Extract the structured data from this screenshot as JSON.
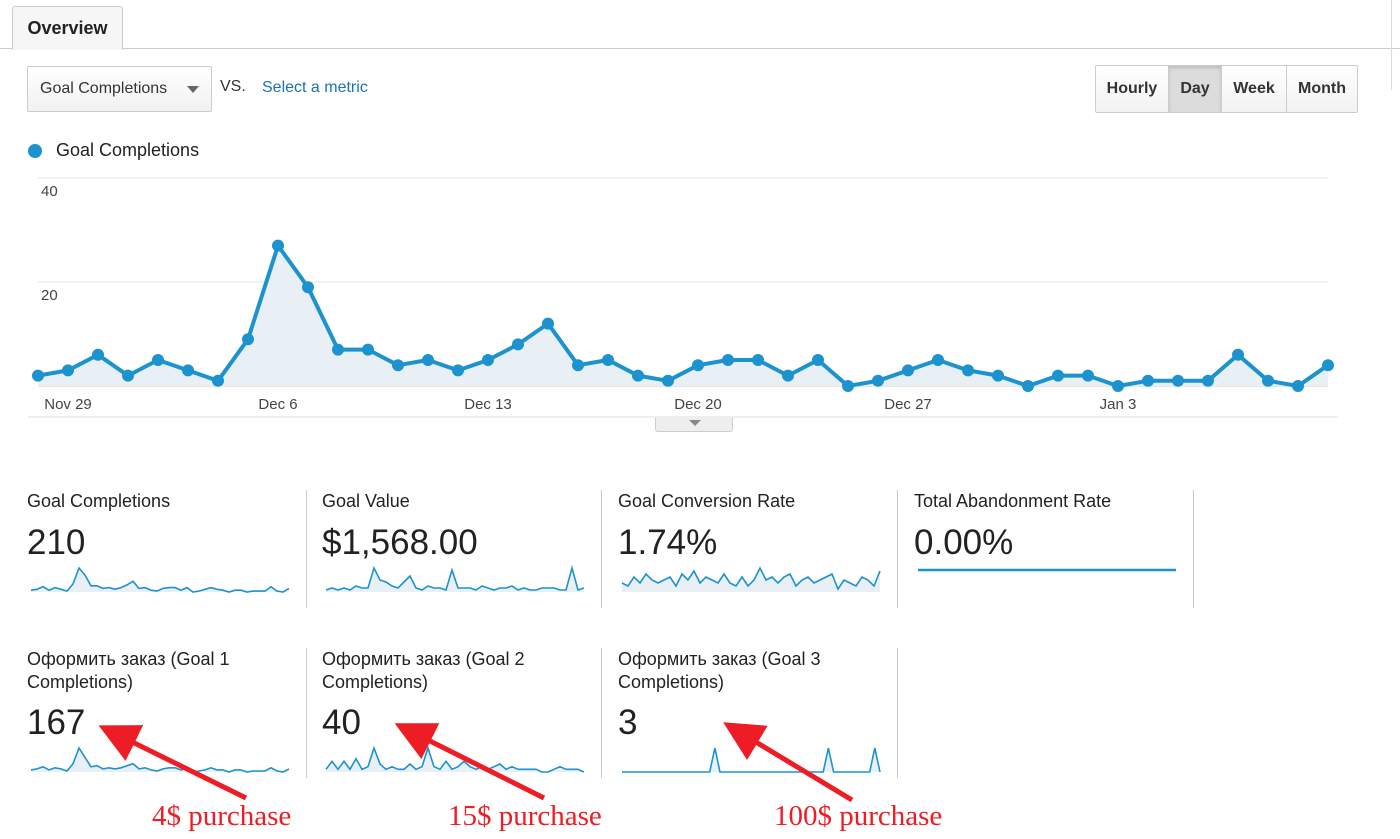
{
  "tabs": [
    {
      "label": "Overview"
    }
  ],
  "controls": {
    "metric": "Goal Completions",
    "vs": "VS.",
    "select_metric": "Select a metric",
    "periods": [
      "Hourly",
      "Day",
      "Week",
      "Month"
    ],
    "active_period": "Day"
  },
  "legend": {
    "label": "Goal Completions",
    "color": "#1c92cf"
  },
  "chart_data": {
    "type": "area",
    "series": [
      {
        "name": "Goal Completions",
        "color": "#1c92cf",
        "values": [
          2,
          3,
          6,
          2,
          5,
          3,
          1,
          9,
          27,
          19,
          7,
          7,
          4,
          5,
          3,
          5,
          8,
          12,
          4,
          5,
          2,
          1,
          4,
          5,
          5,
          2,
          5,
          0,
          1,
          3,
          5,
          3,
          2,
          0,
          2,
          2,
          0,
          1,
          1,
          1,
          6,
          1,
          0,
          4
        ]
      }
    ],
    "x_ticks": [
      "Nov 29",
      "Dec 6",
      "Dec 13",
      "Dec 20",
      "Dec 27",
      "Jan 3"
    ],
    "y_ticks": [
      "20",
      "40"
    ],
    "ylim": [
      0,
      40
    ],
    "grid": true
  },
  "scorecards": [
    {
      "label": "Goal Completions",
      "value": "210",
      "spark": [
        2,
        3,
        6,
        2,
        5,
        3,
        1,
        9,
        27,
        19,
        7,
        7,
        4,
        5,
        3,
        5,
        8,
        12,
        4,
        5,
        2,
        1,
        4,
        5,
        5,
        2,
        5,
        0,
        1,
        3,
        5,
        3,
        2,
        0,
        2,
        2,
        0,
        1,
        1,
        1,
        6,
        1,
        0,
        4
      ]
    },
    {
      "label": "Goal Value",
      "value": "$1,568.00",
      "spark": [
        1,
        2,
        1,
        2,
        1,
        3,
        2,
        2,
        12,
        6,
        5,
        3,
        2,
        5,
        8,
        2,
        1,
        3,
        2,
        2,
        1,
        11,
        2,
        2,
        2,
        1,
        3,
        2,
        1,
        2,
        2,
        3,
        1,
        2,
        1,
        1,
        2,
        2,
        2,
        1,
        1,
        12,
        1,
        2
      ]
    },
    {
      "label": "Goal Conversion Rate",
      "value": "1.74%",
      "spark": [
        3,
        2,
        5,
        3,
        6,
        4,
        3,
        4,
        5,
        2,
        6,
        4,
        7,
        3,
        5,
        4,
        3,
        6,
        3,
        2,
        5,
        2,
        4,
        8,
        4,
        5,
        3,
        5,
        6,
        2,
        4,
        5,
        3,
        4,
        5,
        6,
        1,
        4,
        3,
        2,
        5,
        4,
        2,
        7
      ]
    },
    {
      "label": "Total Abandonment Rate",
      "value": "0.00%",
      "spark": [
        1,
        1,
        1,
        1,
        1,
        1,
        1,
        1,
        1,
        1,
        1,
        1,
        1,
        1,
        1,
        1,
        1,
        1,
        1,
        1,
        1,
        1,
        1,
        1,
        1,
        1,
        1,
        1,
        1,
        1,
        1,
        1,
        1,
        1,
        1,
        1,
        1,
        1,
        1,
        1,
        1,
        1,
        1,
        1
      ]
    },
    {
      "label": "Оформить заказ (Goal 1 Completions)",
      "value": "167",
      "spark": [
        2,
        3,
        5,
        2,
        4,
        3,
        1,
        8,
        23,
        14,
        5,
        6,
        3,
        4,
        3,
        4,
        6,
        8,
        3,
        4,
        2,
        1,
        3,
        4,
        4,
        2,
        4,
        0,
        1,
        2,
        4,
        2,
        2,
        0,
        2,
        2,
        0,
        1,
        1,
        1,
        4,
        1,
        0,
        3
      ]
    },
    {
      "label": "Оформить заказ (Goal 2 Completions)",
      "value": "40",
      "spark": [
        1,
        4,
        1,
        4,
        1,
        5,
        1,
        2,
        9,
        3,
        1,
        2,
        1,
        1,
        3,
        1,
        2,
        9,
        2,
        1,
        4,
        1,
        2,
        4,
        2,
        1,
        2,
        1,
        2,
        3,
        1,
        2,
        1,
        1,
        1,
        1,
        0,
        0,
        1,
        2,
        1,
        1,
        1,
        0
      ]
    },
    {
      "label": "Оформить заказ (Goal 3 Completions)",
      "value": "3",
      "spark": [
        0,
        0,
        0,
        0,
        0,
        0,
        0,
        0,
        0,
        0,
        0,
        0,
        0,
        0,
        0,
        0,
        0,
        0,
        1,
        0,
        0,
        0,
        0,
        0,
        0,
        0,
        0,
        0,
        0,
        0,
        0,
        0,
        0,
        0,
        0,
        0,
        0,
        0,
        0,
        0,
        1,
        0,
        0,
        0,
        0,
        0,
        0,
        0,
        0,
        1,
        0
      ]
    }
  ],
  "annotations": [
    "4$ purchase",
    "15$ purchase",
    "100$ purchase"
  ],
  "annotation_color": "#ee1c24"
}
